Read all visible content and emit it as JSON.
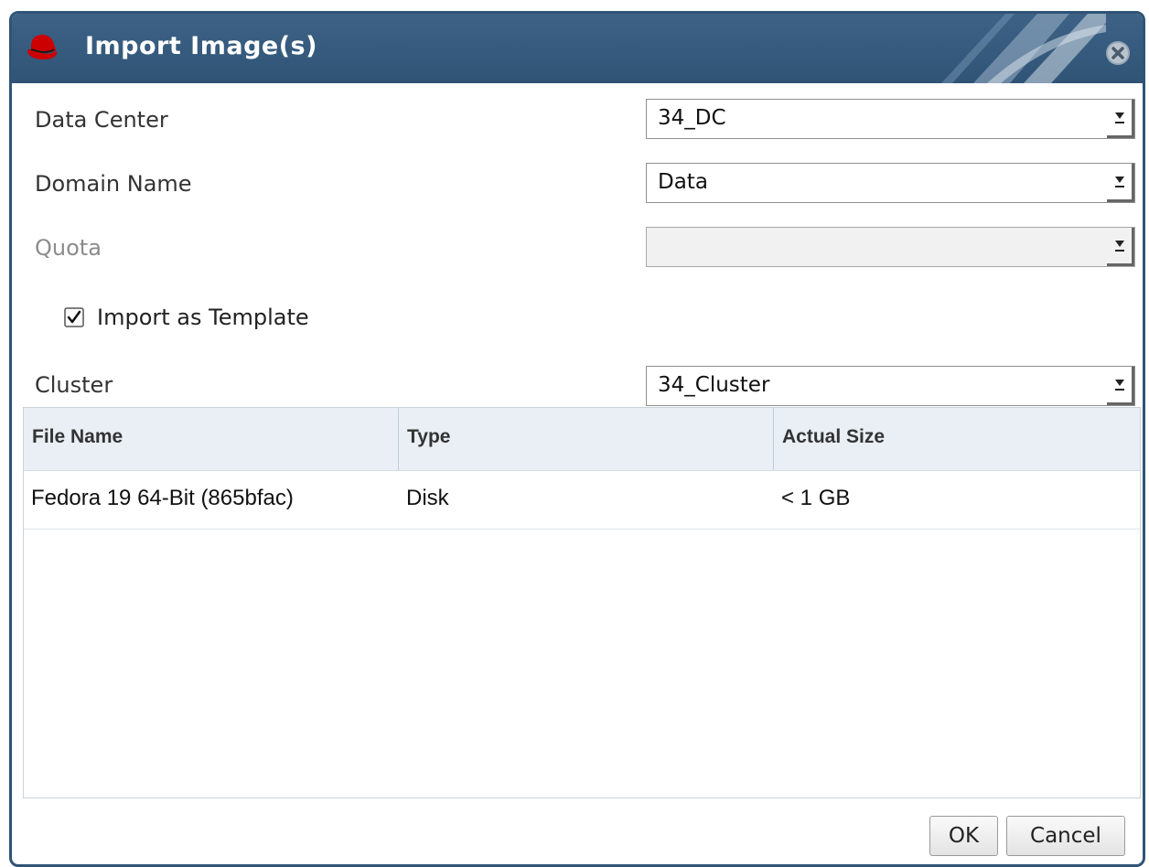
{
  "dialog": {
    "title": "Import Image(s)",
    "accent_color": "#2f5476"
  },
  "form": {
    "data_center": {
      "label": "Data Center",
      "value": "34_DC"
    },
    "domain_name": {
      "label": "Domain Name",
      "value": "Data"
    },
    "quota": {
      "label": "Quota",
      "value": "",
      "disabled": true
    },
    "import_as_template": {
      "label": "Import as Template",
      "checked": true
    },
    "cluster": {
      "label": "Cluster",
      "value": "34_Cluster"
    }
  },
  "table": {
    "columns": [
      "File Name",
      "Type",
      "Actual Size"
    ],
    "rows": [
      {
        "file_name": "Fedora 19 64-Bit (865bfac)",
        "type": "Disk",
        "actual_size": "< 1 GB"
      }
    ]
  },
  "buttons": {
    "ok": "OK",
    "cancel": "Cancel"
  }
}
